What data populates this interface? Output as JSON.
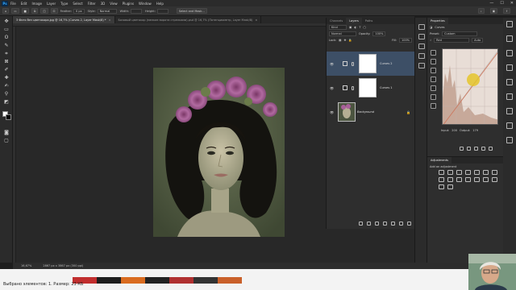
{
  "menubar": {
    "logo": "Ps",
    "items": [
      "File",
      "Edit",
      "Image",
      "Layer",
      "Type",
      "Select",
      "Filter",
      "3D",
      "View",
      "Plugins",
      "Window",
      "Help"
    ],
    "window_controls": [
      "—",
      "☐",
      "✕"
    ]
  },
  "options": {
    "feather_label": "Feather:",
    "feather_value": "0 px",
    "style_label": "Style:",
    "style_value": "Normal",
    "width_label": "Width:",
    "height_label": "Height:",
    "select_mask": "Select and Mask..."
  },
  "tabs": [
    {
      "label": "3 Фото без цветокора.jpg @ 16,7% (Curves 2, Layer Mask/8) *",
      "active": true
    },
    {
      "label": "Базовый цветокор (мелкие ворота стрелками).psd @ 16,7% (Потенциометр, Layer Mask/8)",
      "active": false
    }
  ],
  "layers_panel": {
    "tabs": [
      "Channels",
      "Layers",
      "Paths"
    ],
    "active_tab": "Layers",
    "filter": "Kind",
    "blend_mode": "Normal",
    "opacity_label": "Opacity:",
    "opacity_value": "100%",
    "lock_label": "Lock:",
    "fill_label": "Fill:",
    "fill_value": "100%",
    "layers": [
      {
        "name": "Curves 2",
        "selected": true
      },
      {
        "name": "Curves 1",
        "selected": false
      },
      {
        "name": "Background",
        "selected": false
      }
    ]
  },
  "properties": {
    "title": "Properties",
    "type": "Curves",
    "preset_label": "Preset:",
    "preset_value": "Custom",
    "channel_value": "Red",
    "auto_label": "Auto",
    "input_label": "Input:",
    "input_value": "200",
    "output_label": "Output:",
    "output_value": "179"
  },
  "adjustments": {
    "title": "Adjustments",
    "subtitle": "Add an adjustment"
  },
  "status": {
    "zoom": "16,67%",
    "doc": "2867 px x 3867 px (300 ppi)"
  },
  "taskbar": {
    "text": "Выбрано элементов: 1. Размер: 23 КБ"
  },
  "colors": {
    "accent": "#31a8ff",
    "selection": "#3d4f66",
    "canvas_bg": "#5a6447",
    "histogram_curve": "#d0755a"
  }
}
